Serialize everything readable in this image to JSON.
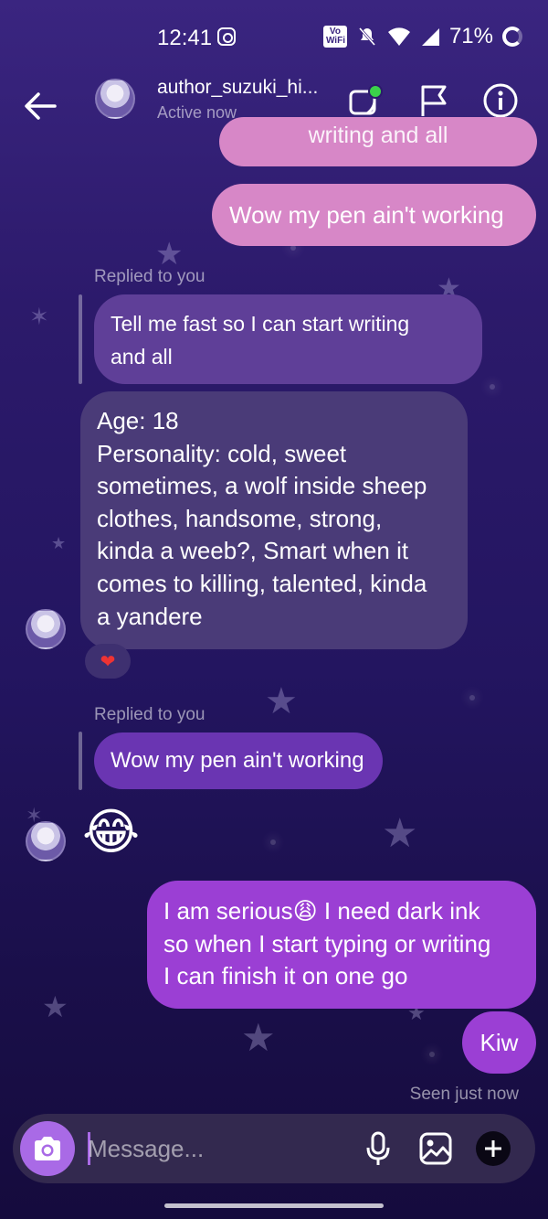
{
  "status_bar": {
    "time": "12:41",
    "network_badge": "Vo WiFi",
    "battery": "71%",
    "icons": [
      "instagram-icon",
      "volte-icon",
      "mute-icon",
      "wifi-icon",
      "signal-icon",
      "battery-icon"
    ]
  },
  "header": {
    "username": "author_suzuki_hi...",
    "status": "Active now",
    "icons": [
      "back-arrow-icon",
      "video-call-icon",
      "flag-icon",
      "info-icon"
    ]
  },
  "messages": {
    "partial_sent": "writing and all",
    "sent_1": "Wow my pen ain't working",
    "reply_label_1": "Replied to you",
    "quoted_1_line1": "Tell me fast so I can start writing",
    "quoted_1_line2": "and all",
    "received_1": [
      "Age: 18",
      "Personality: cold, sweet",
      "sometimes, a wolf inside sheep",
      "clothes, handsome, strong,",
      "kinda a weeb?, Smart when it",
      "comes to killing, talented, kinda",
      "a yandere"
    ],
    "reaction": "❤",
    "reply_label_2": "Replied to you",
    "quoted_2": "Wow my pen ain't working",
    "received_emoji": "😂",
    "sent_2": [
      "I am serious😩 I need dark ink",
      "so when I start typing or writing",
      "I can finish it on one go"
    ],
    "sent_3": "Kiw",
    "seen": "Seen just now"
  },
  "composer": {
    "placeholder": "Message...",
    "icons": [
      "camera-icon",
      "microphone-icon",
      "gallery-icon",
      "add-icon"
    ]
  },
  "colors": {
    "accent": "#a96ae6",
    "sent_pink": "#d787c7",
    "sent_violet": "#9b3fd4",
    "received_purple": "#5f3f98",
    "received_grey": "#4a3b78"
  }
}
